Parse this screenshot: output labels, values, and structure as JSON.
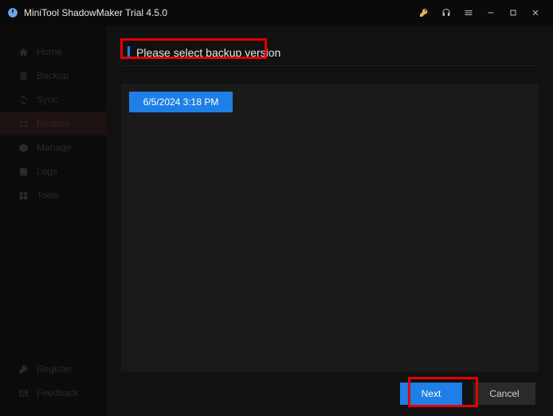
{
  "app": {
    "title": "MiniTool ShadowMaker Trial 4.5.0"
  },
  "sidebar": {
    "items": [
      {
        "label": "Home"
      },
      {
        "label": "Backup"
      },
      {
        "label": "Sync"
      },
      {
        "label": "Restore"
      },
      {
        "label": "Manage"
      },
      {
        "label": "Logs"
      },
      {
        "label": "Tools"
      }
    ],
    "bottom": [
      {
        "label": "Register"
      },
      {
        "label": "Feedback"
      }
    ]
  },
  "main": {
    "header": "Please select backup version",
    "versions": [
      {
        "label": "6/5/2024 3:18 PM"
      }
    ],
    "buttons": {
      "next": "Next",
      "cancel": "Cancel"
    }
  }
}
